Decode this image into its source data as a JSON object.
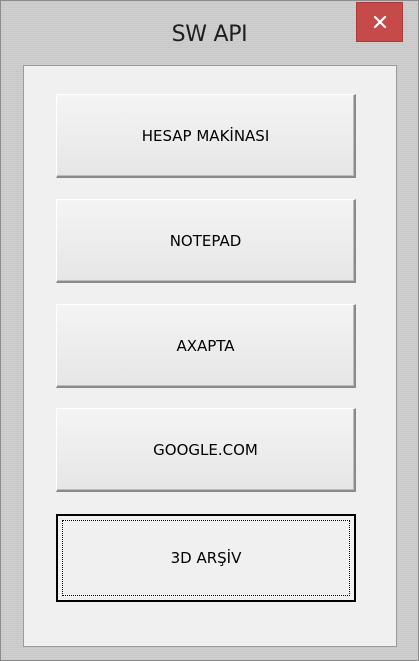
{
  "window": {
    "title": "SW API",
    "close_label": "✕"
  },
  "buttons": [
    {
      "label": "HESAP MAKİNASI"
    },
    {
      "label": "NOTEPAD"
    },
    {
      "label": "AXAPTA"
    },
    {
      "label": "GOOGLE.COM"
    },
    {
      "label": "3D ARŞİV",
      "focused": true
    }
  ],
  "colors": {
    "close_button": "#c74a4a",
    "client_area": "#f0f0f0",
    "frame": "#cfcfcf"
  }
}
